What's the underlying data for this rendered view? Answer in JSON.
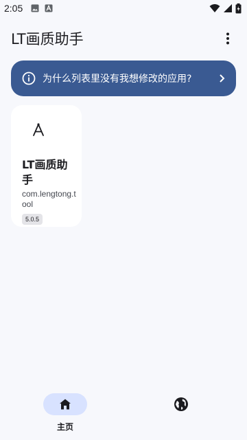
{
  "status_bar": {
    "time": "2:05",
    "left_icons": [
      "image-icon",
      "text-a-icon"
    ],
    "right_icons": [
      "wifi-icon",
      "signal-icon",
      "battery-icon"
    ]
  },
  "app_bar": {
    "title": "LT画质助手",
    "menu_icon": "more-vert-icon"
  },
  "banner": {
    "icon": "info-icon",
    "text": "为什么列表里没有我想修改的应用?",
    "chevron": "chevron-right-icon",
    "color": "#3a5a92"
  },
  "apps": [
    {
      "icon": "compass-drafting-icon",
      "name": "LT画质助手",
      "package": "com.lengtong.tool",
      "version": "5.0.5"
    }
  ],
  "bottom_nav": {
    "items": [
      {
        "label": "主页",
        "icon": "home-icon",
        "active": true
      },
      {
        "label": "",
        "icon": "globe-icon",
        "active": false
      }
    ],
    "active_color": "#d8e2ff"
  }
}
